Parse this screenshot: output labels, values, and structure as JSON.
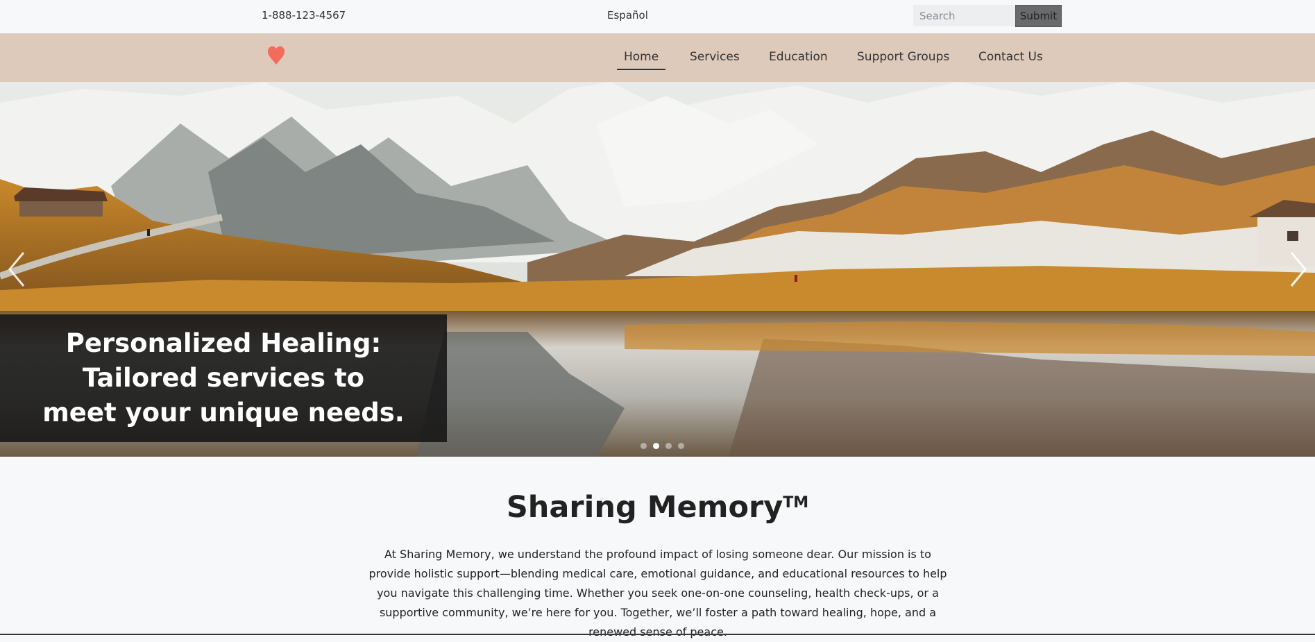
{
  "topbar": {
    "phone": "1-888-123-4567",
    "language": "Español",
    "search_placeholder": "Search",
    "submit_label": "Submit"
  },
  "navbar": {
    "logo_icon": "heart-icon",
    "logo_color": "#f26b5b",
    "items": [
      {
        "label": "Home",
        "active": true
      },
      {
        "label": "Services",
        "active": false
      },
      {
        "label": "Education",
        "active": false
      },
      {
        "label": "Support Groups",
        "active": false
      },
      {
        "label": "Contact Us",
        "active": false
      }
    ],
    "background": "#decabb"
  },
  "hero": {
    "caption_lines": [
      "Personalized Healing:",
      "Tailored services to",
      "meet your unique needs."
    ],
    "slide_count": 4,
    "active_slide": 2,
    "prev_icon": "chevron-left-icon",
    "next_icon": "chevron-right-icon"
  },
  "about": {
    "title": "Sharing Memory",
    "trademark": "TM",
    "text": "At Sharing Memory, we understand the profound impact of losing someone dear. Our mission is to provide holistic support—blending medical care, emotional guidance, and educational resources to help you navigate this challenging time. Whether you seek one-on-one counseling, health check-ups, or a supportive community, we’re here for you. Together, we’ll foster a path toward healing, hope, and a renewed sense of peace."
  }
}
